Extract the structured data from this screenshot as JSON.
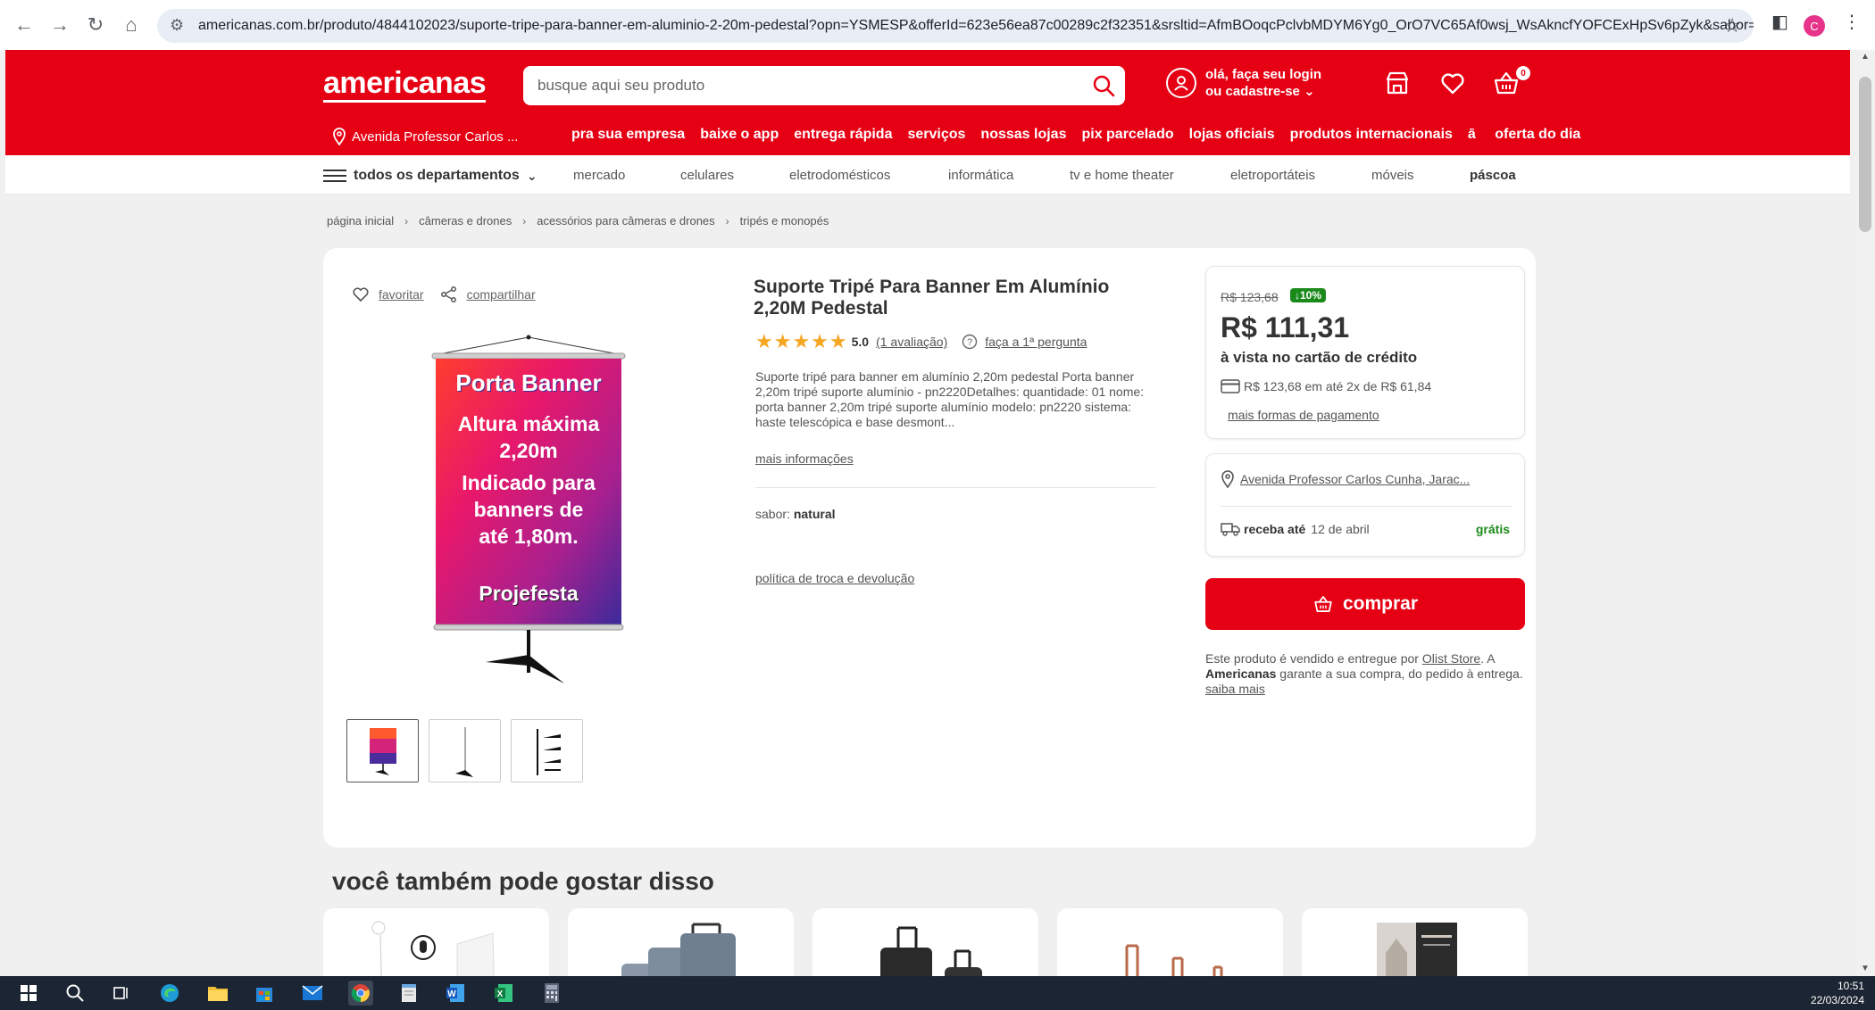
{
  "browser": {
    "url": "americanas.com.br/produto/4844102023/suporte-tripe-para-banner-em-aluminio-2-20m-pedestal?opn=YSMESP&offerId=623e56ea87c00289c2f32351&srsltid=AfmBOoqcPclvbMDYM6Yg0_OrO7VC65Af0wsj_WsAkncfYOFCExHpSv6pZyk&sabor=Natural...",
    "profile_initial": "C"
  },
  "header": {
    "logo": "americanas",
    "search_placeholder": "busque aqui seu produto",
    "login_line1": "olá, faça seu login",
    "login_line2": "ou cadastre-se",
    "cart_count": "0",
    "address": "Avenida Professor Carlos ...",
    "quicklinks": [
      "pra sua empresa",
      "baixe o app",
      "entrega rápida",
      "serviços",
      "nossas lojas",
      "pix parcelado",
      "lojas oficiais",
      "produtos internacionais",
      "oferta do dia"
    ]
  },
  "departments": {
    "all_label": "todos os departamentos",
    "items": [
      "mercado",
      "celulares",
      "eletrodomésticos",
      "informática",
      "tv e home theater",
      "eletroportáteis",
      "móveis",
      "páscoa"
    ]
  },
  "breadcrumb": [
    "página inicial",
    "câmeras e drones",
    "acessórios para câmeras e drones",
    "tripés e monopés"
  ],
  "product": {
    "favorite_label": "favoritar",
    "share_label": "compartilhar",
    "banner_text": {
      "title": "Porta Banner",
      "line1": "Altura máxima",
      "line2": "2,20m",
      "line3": "Indicado para",
      "line4": "banners de",
      "line5": "até 1,80m.",
      "brand": "Projefesta"
    },
    "title": "Suporte Tripé Para Banner Em Alumínio 2,20M Pedestal",
    "rating": "5.0",
    "reviews_link": "(1 avaliação)",
    "question_link": "faça a 1ª pergunta",
    "description": "Suporte tripé para banner em alumínio 2,20m pedestal Porta banner 2,20m tripé suporte alumínio - pn2220Detalhes: quantidade: 01 nome: porta banner 2,20m tripé suporte alumínio modelo: pn2220 sistema: haste telescópica e base desmont...",
    "more_info": "mais informações",
    "flavor_label": "sabor:",
    "flavor_value": "natural",
    "policy_link": "política de troca e devolução"
  },
  "pricing": {
    "old_price": "R$ 123,68",
    "discount": "↓10%",
    "price": "R$ 111,31",
    "price_note": "à vista no cartão de crédito",
    "installments": "R$ 123,68 em até 2x de R$ 61,84",
    "payment_link": "mais formas de pagamento"
  },
  "shipping": {
    "address": "Avenida Professor Carlos Cunha, Jarac...",
    "delivery_label": "receba até",
    "delivery_date": "12 de abril",
    "free_label": "grátis"
  },
  "buy_label": "comprar",
  "seller": {
    "prefix": "Este produto é vendido e entregue por",
    "name": "Olist Store",
    "mid1": ". A",
    "brand": "Americanas",
    "mid2": "garante a sua compra, do pedido à entrega.",
    "link": "saiba mais"
  },
  "recommendations_title": "você também pode gostar disso",
  "taskbar": {
    "time": "10:51",
    "date": "22/03/2024"
  },
  "colors": {
    "brand_red": "#e60014",
    "discount_green": "#1b8a1b",
    "star_yellow": "#f5a623"
  }
}
